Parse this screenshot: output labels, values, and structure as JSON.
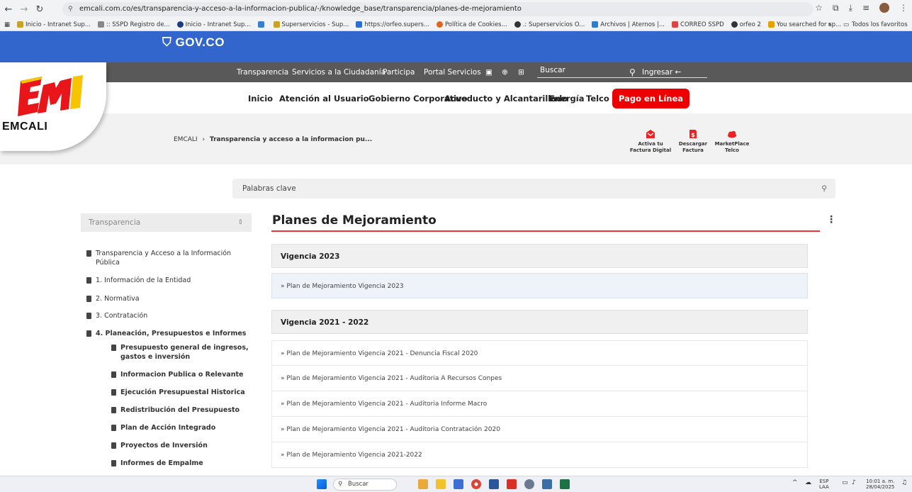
{
  "browser": {
    "url": "emcali.com.co/es/transparencia-y-acceso-a-la-informacion-publica/-/knowledge_base/transparencia/planes-de-mejoramiento",
    "bookmarks": [
      "Inicio - Intranet Sup...",
      ":: SSPD Registro de...",
      "Inicio - Intranet Sup...",
      "",
      "Superservicios - Sup...",
      "https://orfeo.supers...",
      "Política de Cookies...",
      ".: Superservicios O...",
      "Archivos | Aternos |...",
      "CORREO SSPD",
      "orfeo 2",
      "You searched for sp..."
    ],
    "bookmarks_more": "»",
    "all_bookmarks": "Todos los favoritos"
  },
  "gov_banner": {
    "logo": "GOV.CO"
  },
  "top_nav": {
    "items": [
      "Transparencia",
      "Servicios a la Ciudadanía",
      "Participa",
      "Portal Servicios"
    ],
    "search_placeholder": "Buscar",
    "login": "Ingresar"
  },
  "main_nav": {
    "items": [
      "Inicio",
      "Atención al Usuario",
      "Gobierno Corporativo",
      "Acueducto y Alcantarillado",
      "Energía",
      "Telco"
    ],
    "cta": "Pago en Línea"
  },
  "brand": {
    "name": "EMCALI"
  },
  "breadcrumb": {
    "root": "EMCALI",
    "sep": "›",
    "current": "Transparencia y acceso a la informacion pu..."
  },
  "quick_links": [
    {
      "label1": "Activa tu",
      "label2": "Factura Digital",
      "icon": "envelope-icon",
      "color": "#e22"
    },
    {
      "label1": "Descargar",
      "label2": "Factura",
      "icon": "invoice-icon",
      "color": "#e22"
    },
    {
      "label1": "MarketPlace",
      "label2": "Telco",
      "icon": "cloud-icon",
      "color": "#e22"
    }
  ],
  "keyword_search": {
    "placeholder": "Palabras clave"
  },
  "sidebar": {
    "select_value": "Transparencia",
    "items": [
      {
        "label": "Transparencia y Acceso a la Información",
        "label2": "Pública"
      },
      {
        "label": "1. Información de la Entidad"
      },
      {
        "label": "2. Normativa"
      },
      {
        "label": "3. Contratación"
      },
      {
        "label": "4. Planeación, Presupuestos e Informes"
      }
    ],
    "subitems": [
      {
        "label": "Presupuesto general de ingresos,",
        "label2": "gastos e inversión"
      },
      {
        "label": "Informacion Publica o Relevante"
      },
      {
        "label": "Ejecución Presupuestal Historica"
      },
      {
        "label": "Redistribución del Presupuesto"
      },
      {
        "label": "Plan de Acción Integrado"
      },
      {
        "label": "Proyectos de Inversión"
      },
      {
        "label": "Informes de Empalme"
      }
    ]
  },
  "content": {
    "title": "Planes de Mejoramiento",
    "sections": [
      {
        "heading": "Vigencia 2023",
        "rows": [
          "Plan de Mejoramiento Vigencia 2023"
        ]
      },
      {
        "heading": "Vigencia 2021 - 2022",
        "rows": [
          "Plan de Mejoramiento Vigencia 2021 - Denuncia Fiscal 2020",
          "Plan de Mejoramiento Vigencia 2021 - Auditoria A Recursos Conpes",
          "Plan de Mejoramiento Vigencia 2021 - Auditoria Informe Macro",
          "Plan de Mejoramiento Vigencia 2021 - Auditoria Contratación 2020",
          "Plan de Mejoramiento Vigencia 2021-2022"
        ]
      }
    ],
    "row_prefix": "»"
  },
  "taskbar": {
    "search": "Buscar",
    "lang1": "ESP",
    "lang2": "LAA",
    "time": "10:01 a. m.",
    "date": "28/04/2025"
  }
}
